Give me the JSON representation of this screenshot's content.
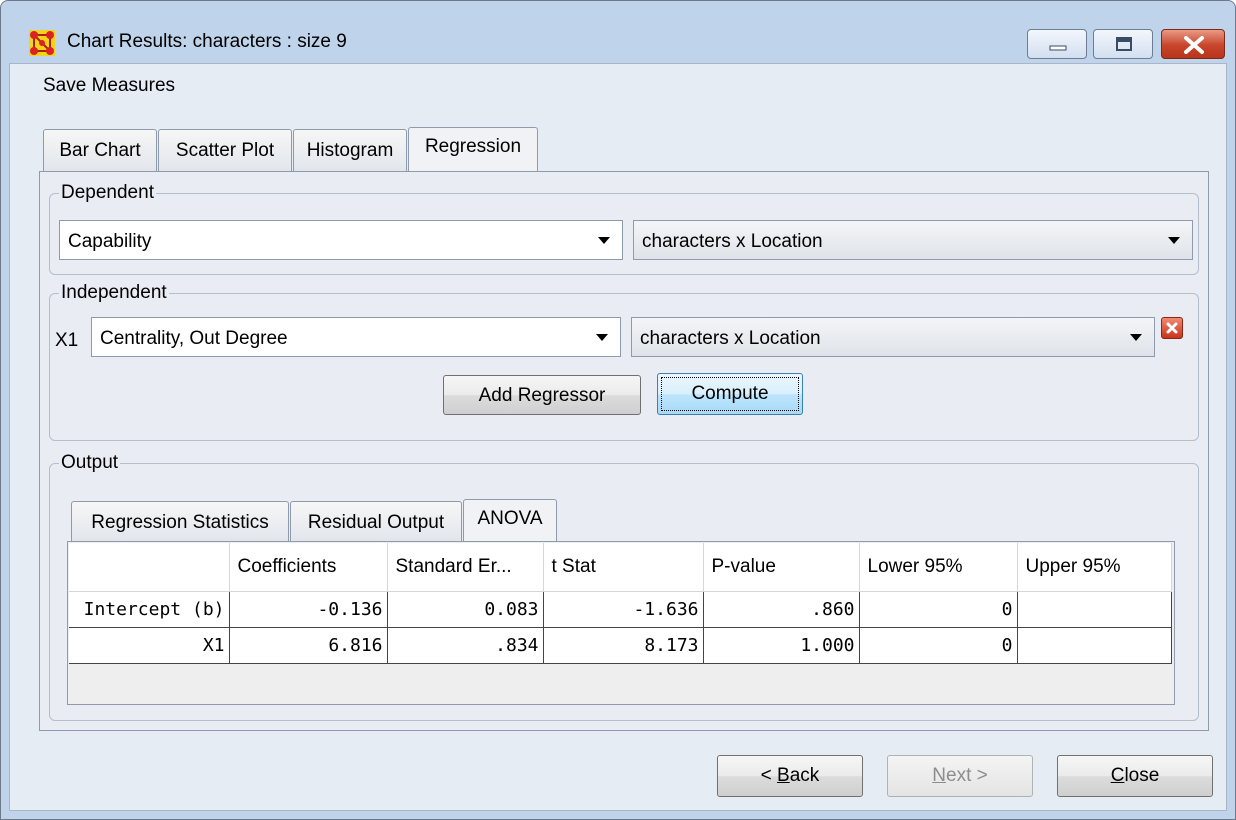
{
  "window": {
    "title": "Chart Results: characters : size 9"
  },
  "menu": {
    "save_measures": "Save Measures"
  },
  "main_tabs": [
    "Bar Chart",
    "Scatter Plot",
    "Histogram",
    "Regression"
  ],
  "dependent": {
    "label": "Dependent",
    "measure": "Capability",
    "network": "characters x Location"
  },
  "independent": {
    "label": "Independent",
    "x_label": "X1",
    "measure": "Centrality, Out Degree",
    "network": "characters x Location",
    "add_regressor": "Add Regressor",
    "compute": "Compute"
  },
  "output": {
    "label": "Output",
    "tabs": [
      "Regression Statistics",
      "Residual Output",
      "ANOVA"
    ],
    "columns": [
      "",
      "Coefficients",
      "Standard Er...",
      "t Stat",
      "P-value",
      "Lower 95%",
      "Upper 95%"
    ],
    "rows": [
      [
        "Intercept (b)",
        "-0.136",
        "0.083",
        "-1.636",
        ".860",
        "0",
        ""
      ],
      [
        "X1",
        "6.816",
        ".834",
        "8.173",
        "1.000",
        "0",
        ""
      ]
    ]
  },
  "footer": {
    "back_pre": "< ",
    "back_key": "B",
    "back_post": "ack",
    "next_key": "N",
    "next_post": "ext >",
    "close_key": "C",
    "close_post": "lose"
  },
  "colors": {
    "frame": "#bfd3ea",
    "client": "#e6ecf4",
    "close_button": "#c8452b"
  },
  "icons": [
    "network-app-icon",
    "minimize-icon",
    "maximize-icon",
    "close-icon",
    "remove-regressor-icon",
    "dropdown-arrow-icon"
  ]
}
